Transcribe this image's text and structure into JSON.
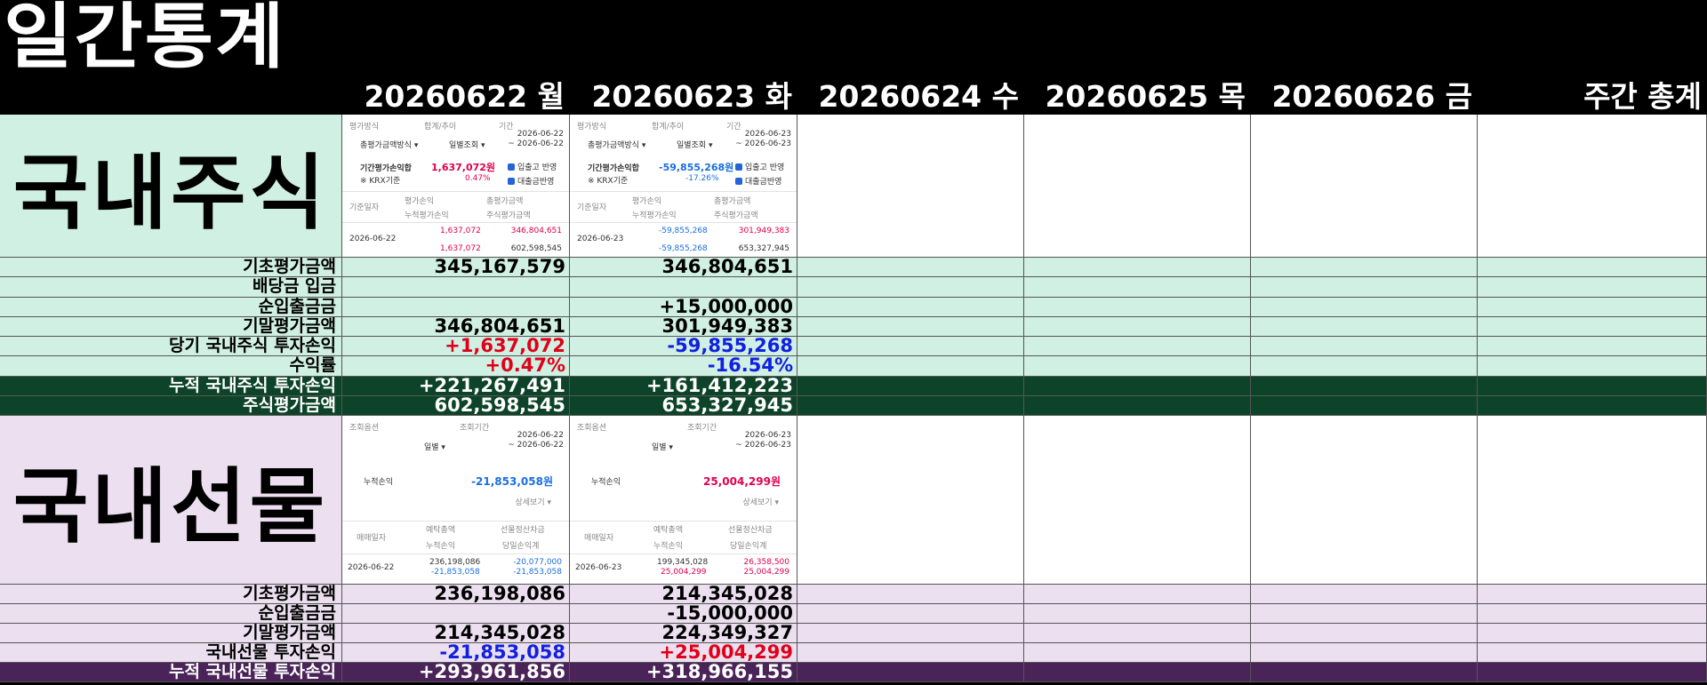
{
  "page_title": "일간통계",
  "day_headers": [
    "20260622 월",
    "20260623 화",
    "20260624 수",
    "20260625 목",
    "20260626 금",
    "주간 총계"
  ],
  "stocks": {
    "section_label": "국내주식",
    "shots": [
      {
        "eval_method_label": "평가방식",
        "sum_label": "합계/추이",
        "period_label": "기간",
        "eval_method_value": "총평가금액방식 ▾",
        "sum_value": "일별조회 ▾",
        "period_start": "2026-06-22",
        "period_end": "~ 2026-06-22",
        "pnl_label": "기간평가손익합",
        "pnl_value": "1,637,072원",
        "rate": "0.47%",
        "krx": "※ KRX기준",
        "opt1": "입출고 반영",
        "opt2": "대출금반영",
        "h_date": "기준일자",
        "h_eval_pnl": "평가손익",
        "h_total_eval": "총평가금액",
        "h_cum_pnl": "누적평가손익",
        "h_stock_eval": "주식평가금액",
        "row_date": "2026-06-22",
        "v_eval_pnl": "1,637,072",
        "v_total_eval": "346,804,651",
        "v_cum_pnl": "1,637,072",
        "v_stock_eval": "602,598,545"
      },
      {
        "eval_method_label": "평가방식",
        "sum_label": "합계/추이",
        "period_label": "기간",
        "eval_method_value": "총평가금액방식 ▾",
        "sum_value": "일별조회 ▾",
        "period_start": "2026-06-23",
        "period_end": "~ 2026-06-23",
        "pnl_label": "기간평가손익합",
        "pnl_value": "-59,855,268원",
        "rate": "-17.26%",
        "krx": "※ KRX기준",
        "opt1": "입출고 반영",
        "opt2": "대출금반영",
        "h_date": "기준일자",
        "h_eval_pnl": "평가손익",
        "h_total_eval": "총평가금액",
        "h_cum_pnl": "누적평가손익",
        "h_stock_eval": "주식평가금액",
        "row_date": "2026-06-23",
        "v_eval_pnl": "-59,855,268",
        "v_total_eval": "301,949,383",
        "v_cum_pnl": "-59,855,268",
        "v_stock_eval": "653,327,945"
      }
    ],
    "rows": [
      {
        "label": "기초평가금액",
        "values": [
          "345,167,579",
          "346,804,651"
        ],
        "tone": [
          "",
          ""
        ],
        "dark": false
      },
      {
        "label": "배당금 입금",
        "values": [
          "",
          ""
        ],
        "tone": [
          "",
          ""
        ],
        "dark": false
      },
      {
        "label": "순입출금금",
        "values": [
          "",
          "+15,000,000"
        ],
        "tone": [
          "",
          ""
        ],
        "dark": false
      },
      {
        "label": "기말평가금액",
        "values": [
          "346,804,651",
          "301,949,383"
        ],
        "tone": [
          "",
          ""
        ],
        "dark": false
      },
      {
        "label": "당기 국내주식 투자손익",
        "values": [
          "+1,637,072",
          "-59,855,268"
        ],
        "tone": [
          "pos",
          "neg"
        ],
        "dark": false
      },
      {
        "label": "수익률",
        "values": [
          "+0.47%",
          "-16.54%"
        ],
        "tone": [
          "pos",
          "neg"
        ],
        "dark": false
      },
      {
        "label": "누적 국내주식 투자손익",
        "values": [
          "+221,267,491",
          "+161,412,223"
        ],
        "tone": [
          "",
          ""
        ],
        "dark": true
      },
      {
        "label": "주식평가금액",
        "values": [
          "602,598,545",
          "653,327,945"
        ],
        "tone": [
          "",
          ""
        ],
        "dark": true
      }
    ]
  },
  "futures": {
    "section_label": "국내선물",
    "shots": [
      {
        "opt_label": "조회옵션",
        "period_label": "조회기간",
        "opt_value": "일별 ▾",
        "period_start": "2026-06-22",
        "period_end": "~ 2026-06-22",
        "cum_label": "누적손익",
        "cum_value": "-21,853,058원",
        "detail": "상세보기 ▾",
        "h_date": "매매일자",
        "h_deposit": "예탁총액",
        "h_cum": "누적손익",
        "h_settle": "선물정산차금",
        "h_daily": "당일손익계",
        "row_date": "2026-06-22",
        "v_deposit": "236,198,086",
        "v_cum": "-21,853,058",
        "v_settle": "-20,077,000",
        "v_daily": "-21,853,058"
      },
      {
        "opt_label": "조회옵션",
        "period_label": "조회기간",
        "opt_value": "일별 ▾",
        "period_start": "2026-06-23",
        "period_end": "~ 2026-06-23",
        "cum_label": "누적손익",
        "cum_value": "25,004,299원",
        "detail": "상세보기 ▾",
        "h_date": "매매일자",
        "h_deposit": "예탁총액",
        "h_cum": "누적손익",
        "h_settle": "선물정산차금",
        "h_daily": "당일손익계",
        "row_date": "2026-06-23",
        "v_deposit": "199,345,028",
        "v_cum": "25,004,299",
        "v_settle": "26,358,500",
        "v_daily": "25,004,299"
      }
    ],
    "rows": [
      {
        "label": "기초평가금액",
        "values": [
          "236,198,086",
          "214,345,028"
        ],
        "tone": [
          "",
          ""
        ],
        "dark": false
      },
      {
        "label": "순입출금금",
        "values": [
          "",
          "-15,000,000"
        ],
        "tone": [
          "",
          ""
        ],
        "dark": false
      },
      {
        "label": "기말평가금액",
        "values": [
          "214,345,028",
          "224,349,327"
        ],
        "tone": [
          "",
          ""
        ],
        "dark": false
      },
      {
        "label": "국내선물 투자손익",
        "values": [
          "-21,853,058",
          "+25,004,299"
        ],
        "tone": [
          "neg",
          "pos"
        ],
        "dark": false
      },
      {
        "label": "누적 국내선물 투자손익",
        "values": [
          "+293,961,856",
          "+318,966,155"
        ],
        "tone": [
          "",
          ""
        ],
        "dark": true
      }
    ]
  }
}
